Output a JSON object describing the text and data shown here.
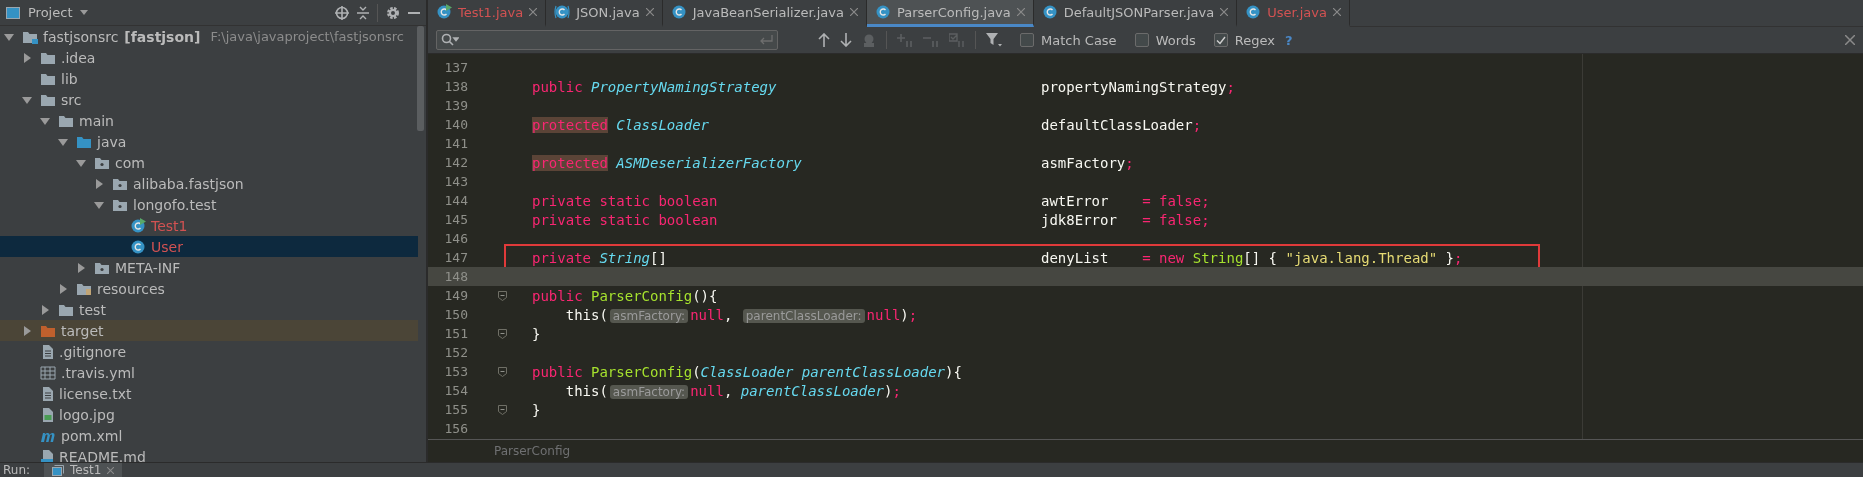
{
  "project_panel": {
    "title": "Project",
    "tree": [
      {
        "label": "fastjsonsrc",
        "module": "[fastjson]",
        "path": "F:\\java\\javaproject\\fastjsonsrc",
        "kind": "module",
        "expanded": true,
        "selected": false,
        "children": [
          {
            "label": ".idea",
            "kind": "folder",
            "expanded": false,
            "selected": false
          },
          {
            "label": "lib",
            "kind": "folder",
            "selected": false
          },
          {
            "label": "src",
            "kind": "folder",
            "expanded": true,
            "selected": false,
            "children": [
              {
                "label": "main",
                "kind": "folder",
                "expanded": true,
                "selected": false,
                "children": [
                  {
                    "label": "java",
                    "kind": "source-folder",
                    "expanded": true,
                    "selected": false,
                    "children": [
                      {
                        "label": "com",
                        "kind": "package",
                        "expanded": true,
                        "selected": false,
                        "children": [
                          {
                            "label": "alibaba.fastjson",
                            "kind": "package",
                            "expanded": false,
                            "selected": false
                          },
                          {
                            "label": "longofo.test",
                            "kind": "package",
                            "expanded": true,
                            "selected": false,
                            "children": [
                              {
                                "label": "Test1",
                                "kind": "runnable-class",
                                "selected": false,
                                "color": "#d25252"
                              },
                              {
                                "label": "User",
                                "kind": "class",
                                "selected": true,
                                "color": "#d25252"
                              }
                            ]
                          }
                        ]
                      },
                      {
                        "label": "META-INF",
                        "kind": "package",
                        "expanded": false,
                        "selected": false
                      }
                    ]
                  },
                  {
                    "label": "resources",
                    "kind": "resource-folder",
                    "expanded": false,
                    "selected": false
                  }
                ]
              },
              {
                "label": "test",
                "kind": "folder",
                "expanded": false,
                "selected": false
              }
            ]
          },
          {
            "label": "target",
            "kind": "excluded-folder",
            "expanded": false,
            "selected": false
          },
          {
            "label": ".gitignore",
            "kind": "text-file",
            "selected": false
          },
          {
            "label": ".travis.yml",
            "kind": "table-file",
            "selected": false
          },
          {
            "label": "license.txt",
            "kind": "text-file",
            "selected": false
          },
          {
            "label": "logo.jpg",
            "kind": "image-file",
            "selected": false
          },
          {
            "label": "pom.xml",
            "kind": "maven-file",
            "selected": false
          },
          {
            "label": "README.md",
            "kind": "markdown-file",
            "selected": false
          }
        ]
      }
    ]
  },
  "editor_tabs": [
    {
      "label": "Test1.java",
      "kind": "runnable-class",
      "selected": false,
      "color": "#d25252"
    },
    {
      "label": "JSON.java",
      "kind": "library-class",
      "selected": false
    },
    {
      "label": "JavaBeanSerializer.java",
      "kind": "class",
      "selected": false
    },
    {
      "label": "ParserConfig.java",
      "kind": "class",
      "selected": true
    },
    {
      "label": "DefaultJSONParser.java",
      "kind": "class",
      "selected": false
    },
    {
      "label": "User.java",
      "kind": "class",
      "selected": false,
      "color": "#d25252"
    }
  ],
  "find_bar": {
    "options": [
      {
        "label": "Match Case",
        "checked": false
      },
      {
        "label": "Words",
        "checked": false
      },
      {
        "label": "Regex",
        "checked": true
      }
    ],
    "help": "?"
  },
  "code_lines": [
    {
      "number": "137"
    },
    {
      "number": "138",
      "code": [
        {
          "kind": "keyword",
          "text": "public "
        },
        {
          "kind": "type",
          "text": "PropertyNamingStrategy"
        }
      ],
      "field": [
        {
          "kind": "plain",
          "text": "propertyNamingStrategy"
        },
        {
          "kind": "keyword",
          "text": ";"
        }
      ]
    },
    {
      "number": "139"
    },
    {
      "number": "140",
      "code": [
        {
          "kind": "flagged-keyword",
          "text": "protected"
        },
        {
          "kind": "type",
          "text": " ClassLoader"
        }
      ],
      "field": [
        {
          "kind": "plain",
          "text": "defaultClassLoader"
        },
        {
          "kind": "keyword",
          "text": ";"
        }
      ]
    },
    {
      "number": "141"
    },
    {
      "number": "142",
      "code": [
        {
          "kind": "flagged-keyword",
          "text": "protected"
        },
        {
          "kind": "type",
          "text": " ASMDeserializerFactory"
        }
      ],
      "field": [
        {
          "kind": "plain",
          "text": "asmFactory"
        },
        {
          "kind": "keyword",
          "text": ";"
        }
      ]
    },
    {
      "number": "143"
    },
    {
      "number": "144",
      "code": [
        {
          "kind": "keyword",
          "text": "private static boolean"
        }
      ],
      "field": [
        {
          "kind": "plain",
          "text": "awtError    "
        },
        {
          "kind": "keyword",
          "text": "= false;"
        }
      ]
    },
    {
      "number": "145",
      "code": [
        {
          "kind": "keyword",
          "text": "private static boolean"
        }
      ],
      "field": [
        {
          "kind": "plain",
          "text": "jdk8Error   "
        },
        {
          "kind": "keyword",
          "text": "= false;"
        }
      ]
    },
    {
      "number": "146"
    },
    {
      "number": "147",
      "boxed": true,
      "code": [
        {
          "kind": "keyword",
          "text": "private "
        },
        {
          "kind": "type",
          "text": "String"
        },
        {
          "kind": "plain",
          "text": "[]"
        }
      ],
      "field": [
        {
          "kind": "plain",
          "text": "denyList    "
        },
        {
          "kind": "keyword",
          "text": "= new "
        },
        {
          "kind": "method",
          "text": "String"
        },
        {
          "kind": "plain",
          "text": "[] { "
        },
        {
          "kind": "string",
          "text": "\"java.lang.Thread\""
        },
        {
          "kind": "plain",
          "text": " }"
        },
        {
          "kind": "keyword",
          "text": ";"
        }
      ]
    },
    {
      "number": "148",
      "current": true
    },
    {
      "number": "149",
      "fold_marker": true,
      "code": [
        {
          "kind": "keyword",
          "text": "public "
        },
        {
          "kind": "method",
          "text": "ParserConfig"
        },
        {
          "kind": "plain",
          "text": "(){"
        }
      ]
    },
    {
      "number": "150",
      "code": [
        {
          "kind": "plain",
          "text": "    this("
        },
        {
          "kind": "hint",
          "text": "asmFactory:"
        },
        {
          "kind": "keyword",
          "text": "null"
        },
        {
          "kind": "plain",
          "text": ", "
        },
        {
          "kind": "hint",
          "text": "parentClassLoader:"
        },
        {
          "kind": "keyword",
          "text": "null"
        },
        {
          "kind": "plain",
          "text": ")"
        },
        {
          "kind": "keyword",
          "text": ";"
        }
      ]
    },
    {
      "number": "151",
      "fold_marker": true,
      "code": [
        {
          "kind": "plain",
          "text": "}"
        }
      ]
    },
    {
      "number": "152"
    },
    {
      "number": "153",
      "fold_marker": true,
      "code": [
        {
          "kind": "keyword",
          "text": "public "
        },
        {
          "kind": "method",
          "text": "ParserConfig"
        },
        {
          "kind": "plain",
          "text": "("
        },
        {
          "kind": "param",
          "text": "ClassLoader parentClassLoader"
        },
        {
          "kind": "plain",
          "text": "){"
        }
      ]
    },
    {
      "number": "154",
      "code": [
        {
          "kind": "plain",
          "text": "    this("
        },
        {
          "kind": "hint",
          "text": "asmFactory:"
        },
        {
          "kind": "keyword",
          "text": "null"
        },
        {
          "kind": "plain",
          "text": ", "
        },
        {
          "kind": "param",
          "text": "parentClassLoader"
        },
        {
          "kind": "plain",
          "text": ")"
        },
        {
          "kind": "keyword",
          "text": ";"
        }
      ]
    },
    {
      "number": "155",
      "fold_marker": true,
      "code": [
        {
          "kind": "plain",
          "text": "}"
        }
      ]
    },
    {
      "number": "156"
    }
  ],
  "breadcrumb": "ParserConfig",
  "run_bar": {
    "label": "Run:",
    "tabs": [
      {
        "label": "Test1",
        "selected": true
      }
    ]
  }
}
